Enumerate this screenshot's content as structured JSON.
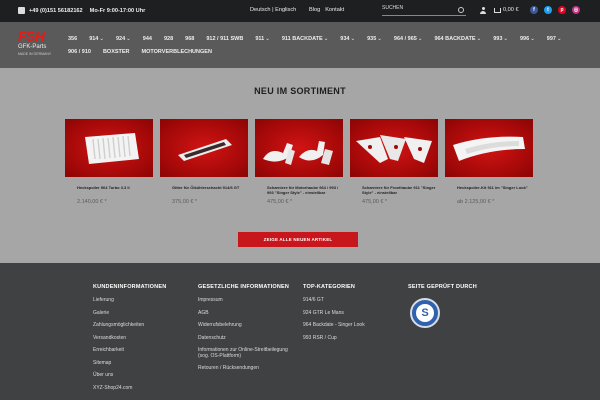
{
  "topbar": {
    "phone": "+49 (0)151 56182162",
    "hours": "Mo-Fr 9:00-17:00 Uhr",
    "lang_de": "Deutsch",
    "lang_sep": "|",
    "lang_en": "Englisch",
    "blog": "Blog",
    "kontakt": "Kontakt",
    "search_placeholder": "SUCHEN",
    "cart_total": "0,00 €",
    "socials": [
      {
        "icon": "facebook-icon",
        "glyph": "f",
        "color": "#3b5998"
      },
      {
        "icon": "twitter-icon",
        "glyph": "t",
        "color": "#1da1f2"
      },
      {
        "icon": "pinterest-icon",
        "glyph": "p",
        "color": "#e60023"
      },
      {
        "icon": "instagram-icon",
        "glyph": "◎",
        "color": "#c13584"
      }
    ]
  },
  "logo": {
    "brand": "FSH",
    "sub": "GFK-Parts",
    "made": "MADE IN GERMANY"
  },
  "nav": [
    {
      "label": "356",
      "caret": false
    },
    {
      "label": "914",
      "caret": true
    },
    {
      "label": "924",
      "caret": true
    },
    {
      "label": "944",
      "caret": false
    },
    {
      "label": "928",
      "caret": false
    },
    {
      "label": "968",
      "caret": false
    },
    {
      "label": "912 / 911 SWB",
      "caret": false
    },
    {
      "label": "911",
      "caret": true
    },
    {
      "label": "911 BACKDATE",
      "caret": true
    },
    {
      "label": "934",
      "caret": true
    },
    {
      "label": "935",
      "caret": true
    },
    {
      "label": "964 / 965",
      "caret": true
    },
    {
      "label": "964 BACKDATE",
      "caret": true
    },
    {
      "label": "993",
      "caret": true
    },
    {
      "label": "996",
      "caret": true
    },
    {
      "label": "997",
      "caret": true
    },
    {
      "label": "906 / 910",
      "caret": false
    },
    {
      "label": "BOXSTER",
      "caret": false
    },
    {
      "label": "MOTORVERBLECHUNGEN",
      "caret": false
    }
  ],
  "main": {
    "title": "NEU IM SORTIMENT",
    "cta": "ZEIGE ALLE NEUEN ARTIKEL",
    "products": [
      {
        "name": "Heckspoiler 964 Turbo 3.3 ll",
        "price": "2.140,00 € *"
      },
      {
        "name": "Gitter für Ölkühlerschacht 914/6 GT",
        "price": "375,00 € *"
      },
      {
        "name": "Scharniere für Motorhaube 964 / 993 / 993 \"Singer Style\" - einstellbar",
        "price": "475,00 € *"
      },
      {
        "name": "Scharniere für Fronthaube 911 \"Singer Style\" - einstellbar",
        "price": "475,00 € *"
      },
      {
        "name": "Heckspoiler-Kit 911 im \"Singer Look\"",
        "price": "ab 2.125,00 € *"
      }
    ]
  },
  "footer": {
    "col1": {
      "title": "KUNDENINFORMATIONEN",
      "links": [
        "Lieferung",
        "Galerie",
        "Zahlungsmöglichkeiten",
        "Versandkosten",
        "Erreichbarkeit",
        "Sitemap",
        "Über uns",
        "XYZ-Shop24.com"
      ]
    },
    "col2": {
      "title": "GESETZLICHE INFORMATIONEN",
      "links": [
        "Impressum",
        "AGB",
        "Widerrufsbelehrung",
        "Datenschutz",
        "Informationen zur Online-Streitbeilegung (sog. OS-Plattform)",
        "Retouren / Rücksendungen"
      ]
    },
    "col3": {
      "title": "TOP-KATEGORIEN",
      "links": [
        "914/6 GT",
        "924 GTR Le Mans",
        "964 Backdate - Singer Look",
        "993 RSR / Cup"
      ]
    },
    "col4": {
      "title": "SEITE GEPRÜFT DURCH",
      "seal_letter": "S"
    }
  }
}
